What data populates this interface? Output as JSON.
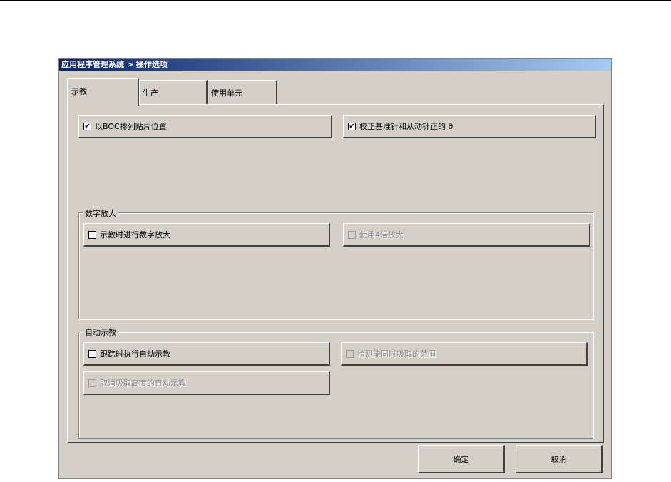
{
  "window": {
    "title": "应用程序管理系统 > 操作选项"
  },
  "tabs": [
    {
      "label": "示教",
      "active": true
    },
    {
      "label": "生产",
      "active": false
    },
    {
      "label": "使用单元",
      "active": false
    }
  ],
  "options": {
    "boc_arrange": {
      "label": "以BOC排列贴片位置",
      "checked": true,
      "enabled": true,
      "check_glyph": "✔"
    },
    "correct_theta": {
      "label": "校正基准针和从动针正的 θ",
      "checked": true,
      "enabled": true,
      "check_glyph": "✔"
    }
  },
  "groups": {
    "digital_zoom": {
      "title": "数字放大",
      "options": {
        "zoom_when_teaching": {
          "label": "示教时进行数字放大",
          "checked": false,
          "enabled": true
        },
        "use_4x": {
          "label": "使用4倍放大",
          "checked": false,
          "enabled": false
        }
      }
    },
    "auto_teach": {
      "title": "自动示教",
      "options": {
        "auto_teach_on_track": {
          "label": "跟踪时执行自动示教",
          "checked": false,
          "enabled": true
        },
        "detect_simultaneous_pick": {
          "label": "检测能同时吸取的范围",
          "checked": false,
          "enabled": false
        },
        "cancel_auto_teach_pick_height": {
          "label": "取消吸取高度的自动示教",
          "checked": false,
          "enabled": false
        }
      }
    }
  },
  "buttons": {
    "ok": "确定",
    "cancel": "取消"
  }
}
